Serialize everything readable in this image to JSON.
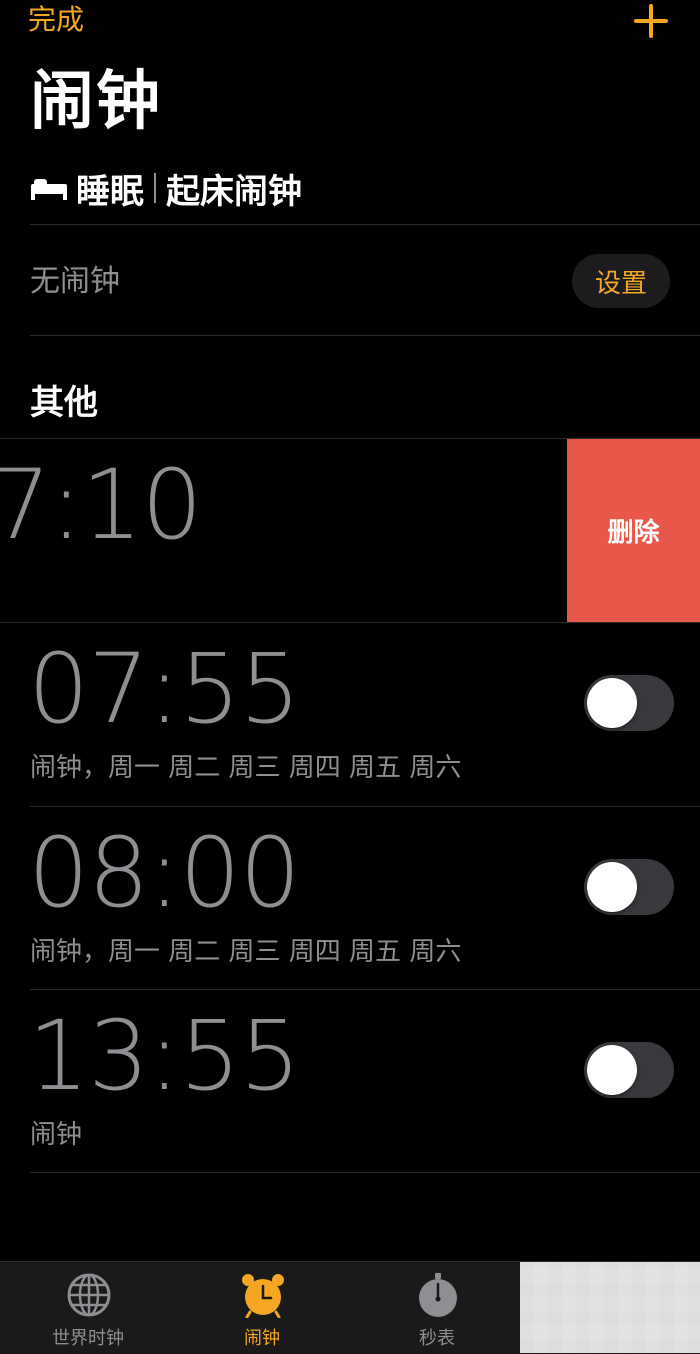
{
  "header": {
    "done_label": "完成",
    "title": "闹钟"
  },
  "sleep": {
    "title_left": "睡眠",
    "title_right": "起床闹钟",
    "no_alarm_label": "无闹钟",
    "set_button_label": "设置"
  },
  "section": {
    "other_label": "其他"
  },
  "alarms": [
    {
      "time": "7:10",
      "label": "",
      "enabled": false,
      "swiped": true
    },
    {
      "time": "07:55",
      "label": "闹钟，周一 周二 周三 周四 周五 周六",
      "enabled": false
    },
    {
      "time": "08:00",
      "label": "闹钟，周一 周二 周三 周四 周五 周六",
      "enabled": false
    },
    {
      "time": "13:55",
      "label": "闹钟",
      "enabled": false
    }
  ],
  "delete_label": "删除",
  "tabs": [
    {
      "label": "世界时钟",
      "icon": "globe-icon",
      "active": false
    },
    {
      "label": "闹钟",
      "icon": "alarm-clock-icon",
      "active": true
    },
    {
      "label": "秒表",
      "icon": "stopwatch-icon",
      "active": false
    }
  ],
  "colors": {
    "accent": "#F5A623",
    "delete": "#E9564A",
    "secondary_text": "#8E8E93",
    "background": "#000000"
  }
}
